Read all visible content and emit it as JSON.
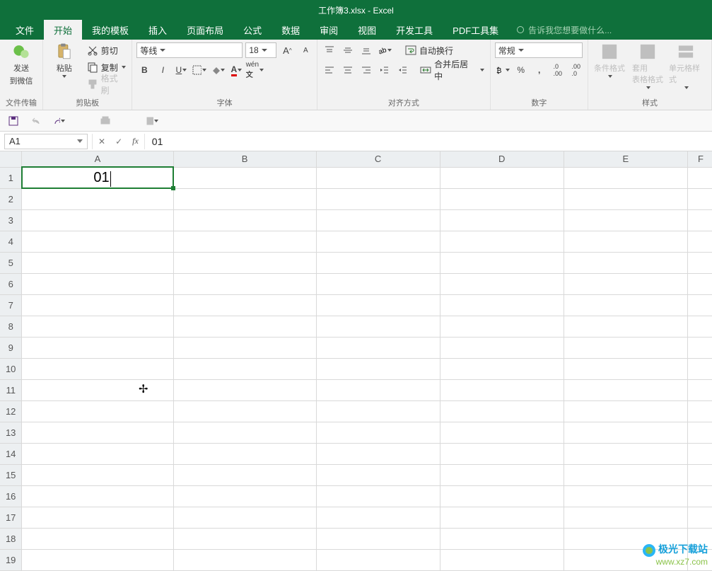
{
  "title": "工作簿3.xlsx - Excel",
  "tabs": [
    "文件",
    "开始",
    "我的模板",
    "插入",
    "页面布局",
    "公式",
    "数据",
    "审阅",
    "视图",
    "开发工具",
    "PDF工具集"
  ],
  "active_tab": 1,
  "tellme": "告诉我您想要做什么...",
  "ribbon": {
    "wechat": {
      "line1": "发送",
      "line2": "到微信",
      "group": "文件传输"
    },
    "clipboard": {
      "paste": "粘贴",
      "cut": "剪切",
      "copy": "复制",
      "format_painter": "格式刷",
      "group": "剪贴板"
    },
    "font": {
      "name": "等线",
      "size": "18",
      "group": "字体"
    },
    "align": {
      "wrap": "自动换行",
      "merge": "合并后居中",
      "group": "对齐方式"
    },
    "number": {
      "format": "常规",
      "group": "数字"
    },
    "styles": {
      "cond": "条件格式",
      "table": "套用\n表格格式",
      "cell": "单元格样式",
      "group": "样式"
    }
  },
  "namebox": "A1",
  "formula": "01",
  "columns": [
    "A",
    "B",
    "C",
    "D",
    "E",
    "F"
  ],
  "rows_count": 19,
  "cells": {
    "A1": "01"
  },
  "selection": {
    "col": "A",
    "row": 1
  },
  "watermark": {
    "l1": "极光下载站",
    "l2": "www.xz7.com"
  }
}
